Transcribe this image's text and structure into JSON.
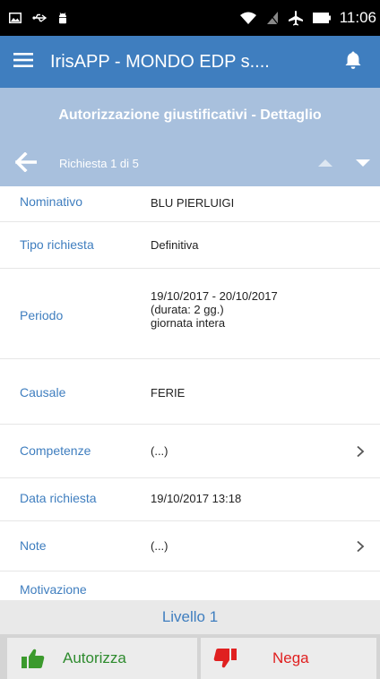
{
  "status_bar": {
    "time": "11:06",
    "icons": [
      "screenshot-icon",
      "usb-icon",
      "android-debug-icon",
      "wifi-icon",
      "no-sim-icon",
      "airplane-icon",
      "battery-icon"
    ]
  },
  "app_bar": {
    "title": "IrisAPP - MONDO EDP s....",
    "menu_icon": "hamburger-menu-icon",
    "bell_icon": "bell-icon"
  },
  "page_header": {
    "title": "Autorizzazione giustificativi - Dettaglio"
  },
  "navigation": {
    "counter": "Richiesta 1 di 5",
    "back_icon": "back-arrow-icon",
    "prev_icon": "caret-up-icon",
    "next_icon": "caret-down-icon"
  },
  "details": {
    "nominativo": {
      "label": "Nominativo",
      "value": "BLU PIERLUIGI"
    },
    "tipo_richiesta": {
      "label": "Tipo richiesta",
      "value": "Definitiva"
    },
    "periodo": {
      "label": "Periodo",
      "line1": "19/10/2017 - 20/10/2017",
      "line2": "(durata: 2 gg.)",
      "line3": "giornata intera"
    },
    "causale": {
      "label": "Causale",
      "value": "FERIE"
    },
    "competenze": {
      "label": "Competenze",
      "value": "(...)"
    },
    "data_richiesta": {
      "label": "Data richiesta",
      "value": "19/10/2017 13:18"
    },
    "note": {
      "label": "Note",
      "value": "(...)"
    },
    "motivazione": {
      "label": "Motivazione"
    }
  },
  "level": {
    "label": "Livello 1"
  },
  "actions": {
    "approve_label": "Autorizza",
    "deny_label": "Nega",
    "approve_icon": "thumbs-up-icon",
    "deny_icon": "thumbs-down-icon"
  },
  "colors": {
    "app_bar": "#3f7ebf",
    "header": "#a8c0dd",
    "label_text": "#3f7ebf",
    "approve": "#2e8b2e",
    "deny": "#e02020"
  }
}
